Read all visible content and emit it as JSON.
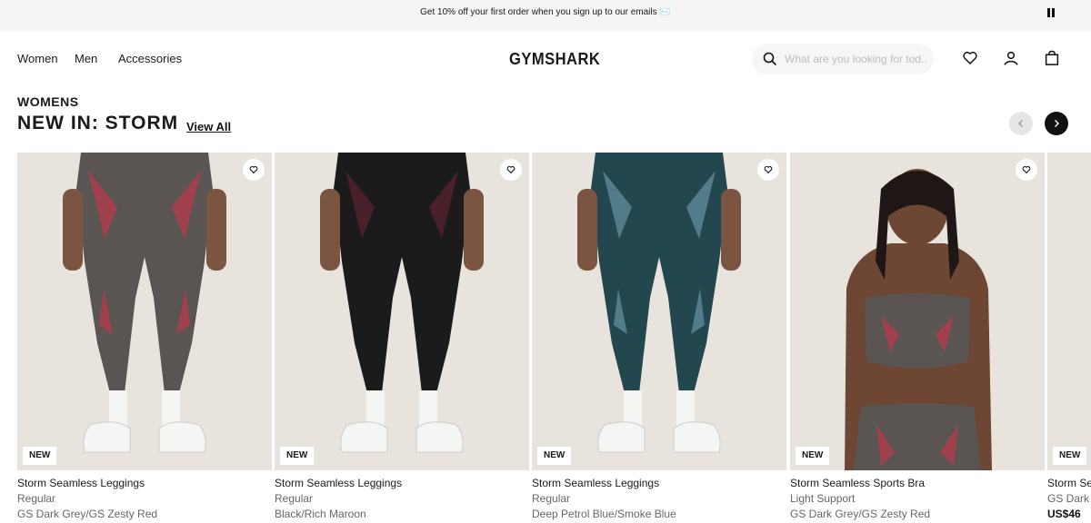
{
  "promo": {
    "text": "Get 10% off your first order when you sign up to our emails ✉️"
  },
  "nav": {
    "links": [
      "Women",
      "Men",
      "Accessories"
    ],
    "logo": "GYMSHARK",
    "search_placeholder": "What are you looking for tod..."
  },
  "section": {
    "eyebrow": "WOMENS",
    "title": "NEW IN: STORM",
    "view_all": "View All"
  },
  "products": [
    {
      "badge": "NEW",
      "name": "Storm Seamless Leggings",
      "fit": "Regular",
      "color": "GS Dark Grey/GS Zesty Red"
    },
    {
      "badge": "NEW",
      "name": "Storm Seamless Leggings",
      "fit": "Regular",
      "color": "Black/Rich Maroon"
    },
    {
      "badge": "NEW",
      "name": "Storm Seamless Leggings",
      "fit": "Regular",
      "color": "Deep Petrol Blue/Smoke Blue"
    },
    {
      "badge": "NEW",
      "name": "Storm Seamless Sports Bra",
      "fit": "Light Support",
      "color": "GS Dark Grey/GS Zesty Red"
    },
    {
      "badge": "NEW",
      "name": "Storm Sea",
      "color": "GS Dark G",
      "price": "US$46"
    }
  ],
  "colors": {
    "background": "#ffffff",
    "promo_bar": "#f4f4f4",
    "image_bg": "#e8e3dc",
    "grey_leggings": "#5a5552",
    "black_leggings": "#1c1b1c",
    "petrol_leggings": "#22474f",
    "accent_red": "#b83a4b"
  }
}
